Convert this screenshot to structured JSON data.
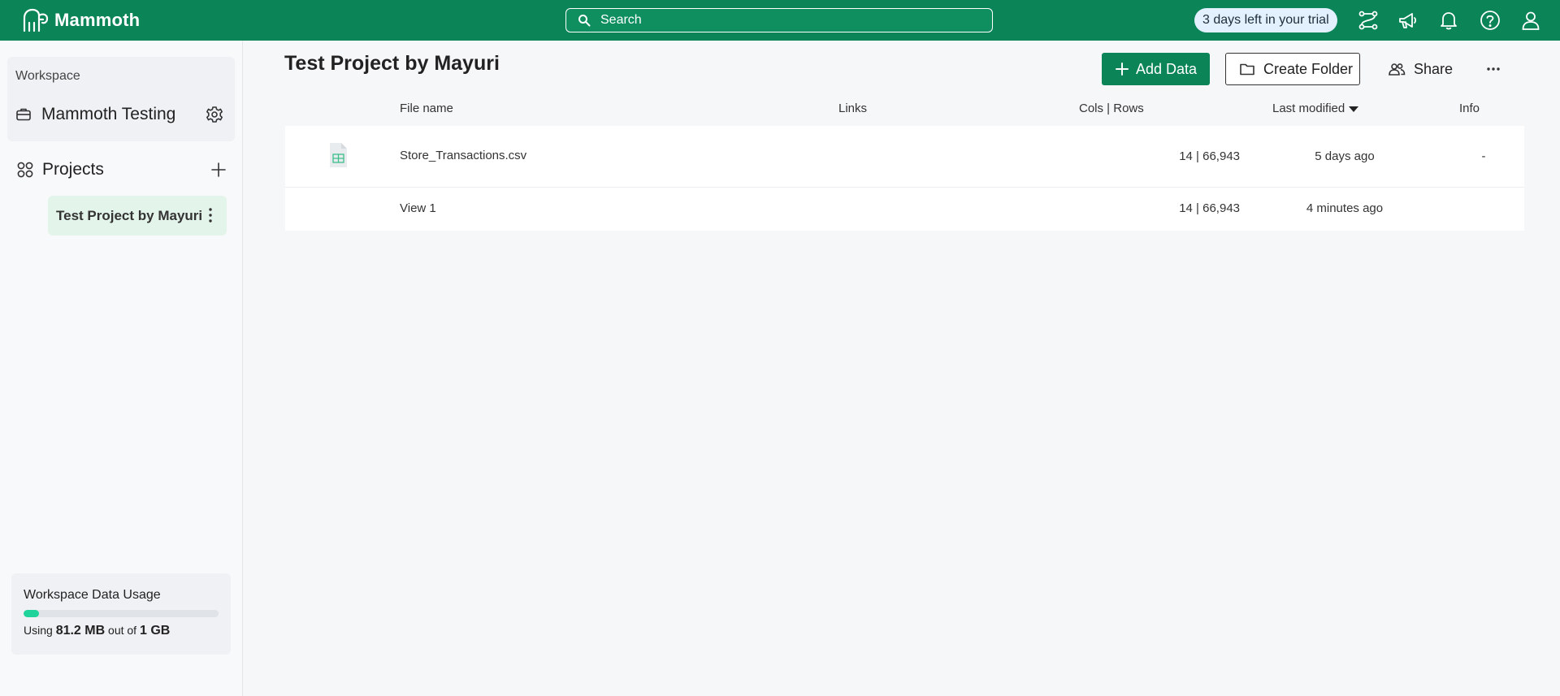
{
  "app": {
    "name": "Mammoth",
    "search_placeholder": "Search",
    "trial_text": "3 days left in your trial"
  },
  "sidebar": {
    "workspace_label": "Workspace",
    "workspace_name": "Mammoth Testing",
    "projects_label": "Projects",
    "projects": [
      {
        "label": "Test Project by Mayuri",
        "selected": true
      }
    ],
    "usage": {
      "title": "Workspace Data Usage",
      "prefix": "Using",
      "used": "81.2 MB",
      "middle": "out of",
      "total": "1 GB",
      "fraction": 0.079
    }
  },
  "main": {
    "title": "Test Project by Mayuri",
    "actions": {
      "add_data": "Add Data",
      "create_folder": "Create Folder",
      "share": "Share"
    },
    "columns": {
      "file_name": "File name",
      "links": "Links",
      "cols_rows": "Cols | Rows",
      "last_modified": "Last modified",
      "info": "Info"
    },
    "rows": [
      {
        "name": "Store_Transactions.csv",
        "cols_rows": "14 | 66,943",
        "modified": "5 days ago",
        "info": "-"
      },
      {
        "name": "View 1",
        "cols_rows": "14 | 66,943",
        "modified": "4 minutes ago",
        "info": ""
      }
    ]
  },
  "colors": {
    "brand": "#0b8457",
    "selected_bg": "#e3f4ea",
    "usage_fill": "#1fd39a"
  },
  "icons": [
    "mammoth-logo-icon",
    "search-icon",
    "workflow-icon",
    "megaphone-icon",
    "bell-icon",
    "help-icon",
    "user-icon",
    "briefcase-icon",
    "gear-icon",
    "projects-icon",
    "plus-icon",
    "kebab-icon",
    "folder-icon",
    "share-users-icon",
    "more-icon",
    "sort-down-icon",
    "csv-file-icon"
  ]
}
